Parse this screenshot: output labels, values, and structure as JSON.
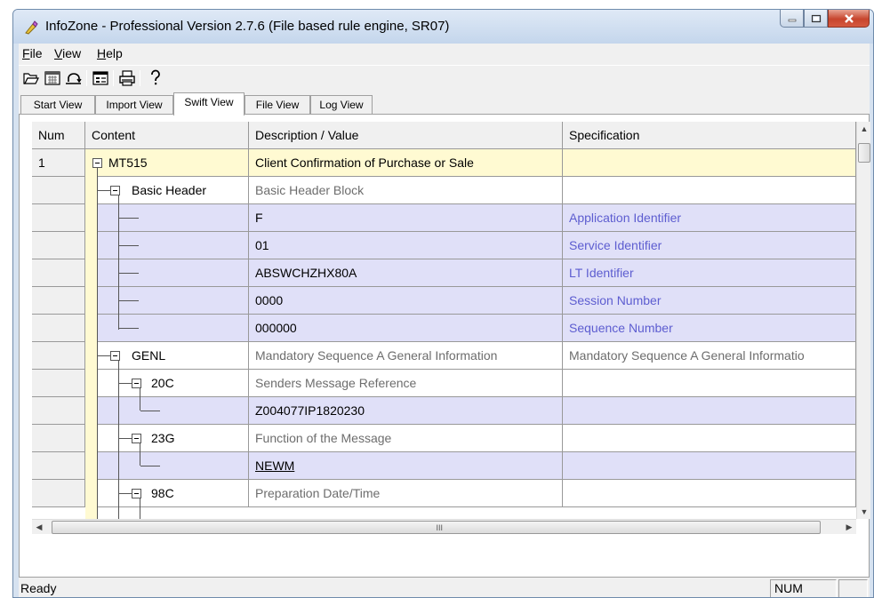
{
  "window": {
    "title": "InfoZone - Professional Version 2.7.6 (File based rule engine,  SR07)"
  },
  "menu": [
    "File",
    "View",
    "Help"
  ],
  "toolbar_icons": [
    "open-folder-icon",
    "calendar-icon",
    "refresh-icon",
    "properties-icon",
    "print-icon",
    "help-icon"
  ],
  "tabs": [
    {
      "label": "Start View",
      "active": false
    },
    {
      "label": "Import View",
      "active": false
    },
    {
      "label": "Swift View",
      "active": true
    },
    {
      "label": "File View",
      "active": false
    },
    {
      "label": "Log View",
      "active": false
    }
  ],
  "grid": {
    "columns": [
      "Num",
      "Content",
      "Description / Value",
      "Specification"
    ],
    "rows": [
      {
        "num": "1",
        "content": "MT515",
        "value": "Client Confirmation of Purchase or Sale",
        "spec": ""
      },
      {
        "num": "",
        "content": "Basic Header",
        "value": "Basic Header Block",
        "spec": ""
      },
      {
        "num": "",
        "content": "",
        "value": "F",
        "spec": "Application Identifier"
      },
      {
        "num": "",
        "content": "",
        "value": "01",
        "spec": "Service Identifier"
      },
      {
        "num": "",
        "content": "",
        "value": "ABSWCHZHX80A",
        "spec": "LT Identifier"
      },
      {
        "num": "",
        "content": "",
        "value": "0000",
        "spec": "Session Number"
      },
      {
        "num": "",
        "content": "",
        "value": "000000",
        "spec": "Sequence Number"
      },
      {
        "num": "",
        "content": "GENL",
        "value": "Mandatory Sequence A General Information",
        "spec": "Mandatory Sequence A General Informatio"
      },
      {
        "num": "",
        "content": "20C",
        "value": "Senders Message Reference",
        "spec": ""
      },
      {
        "num": "",
        "content": "",
        "value": "Z004077IP1820230",
        "spec": ""
      },
      {
        "num": "",
        "content": "23G",
        "value": "Function of the Message",
        "spec": ""
      },
      {
        "num": "",
        "content": "",
        "value": "NEWM",
        "spec": ""
      },
      {
        "num": "",
        "content": "98C",
        "value": "Preparation Date/Time",
        "spec": ""
      }
    ]
  },
  "hscroll_grip": "III",
  "status": {
    "text": "Ready",
    "num_indicator": "NUM"
  },
  "colors": {
    "main_row": "#fffad2",
    "leaf_row": "#e0e0f8",
    "spec_link": "#5d5dd0"
  }
}
